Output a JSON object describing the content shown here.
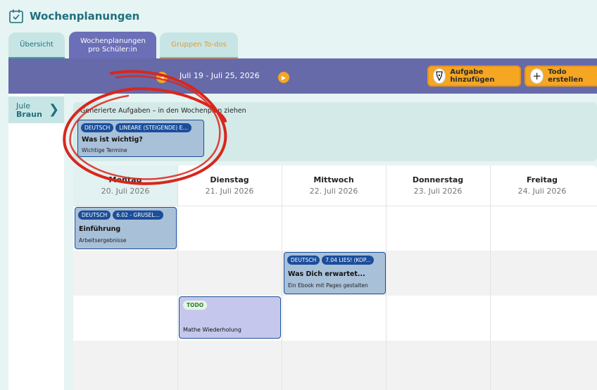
{
  "app": {
    "title": "Wochenplanungen",
    "icon": "calendar-check-icon"
  },
  "tabs": [
    {
      "label": "Übersicht"
    },
    {
      "label": "Wochenplanungen pro Schüler:in",
      "active": true
    },
    {
      "label": "Gruppen To-dos"
    }
  ],
  "toolbar": {
    "week_range": "Juli 19 - Juli 25, 2026",
    "add_task_label": "Aufgabe hinzufügen",
    "add_task_icon": "pen-nib-icon",
    "create_todo_label": "Todo erstellen",
    "create_todo_icon": "plus-icon"
  },
  "student": {
    "first": "Jule",
    "last": "Braun"
  },
  "generated": {
    "title": "Generierte Aufgaben – in den Wochenplan ziehen",
    "card": {
      "tags": [
        "DEUTSCH",
        "LINEARE (STEIGENDE) E..."
      ],
      "title": "Was ist wichtig?",
      "sub": "Wichtige Termine"
    }
  },
  "days": [
    {
      "name": "Montag",
      "date": "20. Juli 2026"
    },
    {
      "name": "Dienstag",
      "date": "21. Juli 2026"
    },
    {
      "name": "Mittwoch",
      "date": "22. Juli 2026"
    },
    {
      "name": "Donnerstag",
      "date": "23. Juli 2026"
    },
    {
      "name": "Freitag",
      "date": "24. Juli 2026"
    }
  ],
  "cards": [
    {
      "tags": [
        "DEUTSCH",
        "6.02 - GRUSEL..."
      ],
      "title": "Einführung",
      "sub": "Arbeitsergebnisse"
    },
    {
      "tags": [
        "DEUTSCH",
        "7.04 LIES! (KOP..."
      ],
      "title": "Was Dich erwartet...",
      "sub": "Ein Ebook mit Pages gestalten"
    }
  ],
  "todo": {
    "tag": "TODO",
    "title": "Mathe Wiederholung"
  },
  "colors": {
    "accent": "#1f6f7e",
    "toolbar": "#666aa9",
    "orange": "#f5a623",
    "card": "#a8c0d8",
    "tag": "#1b4e9b",
    "annotation": "#d9261c"
  }
}
